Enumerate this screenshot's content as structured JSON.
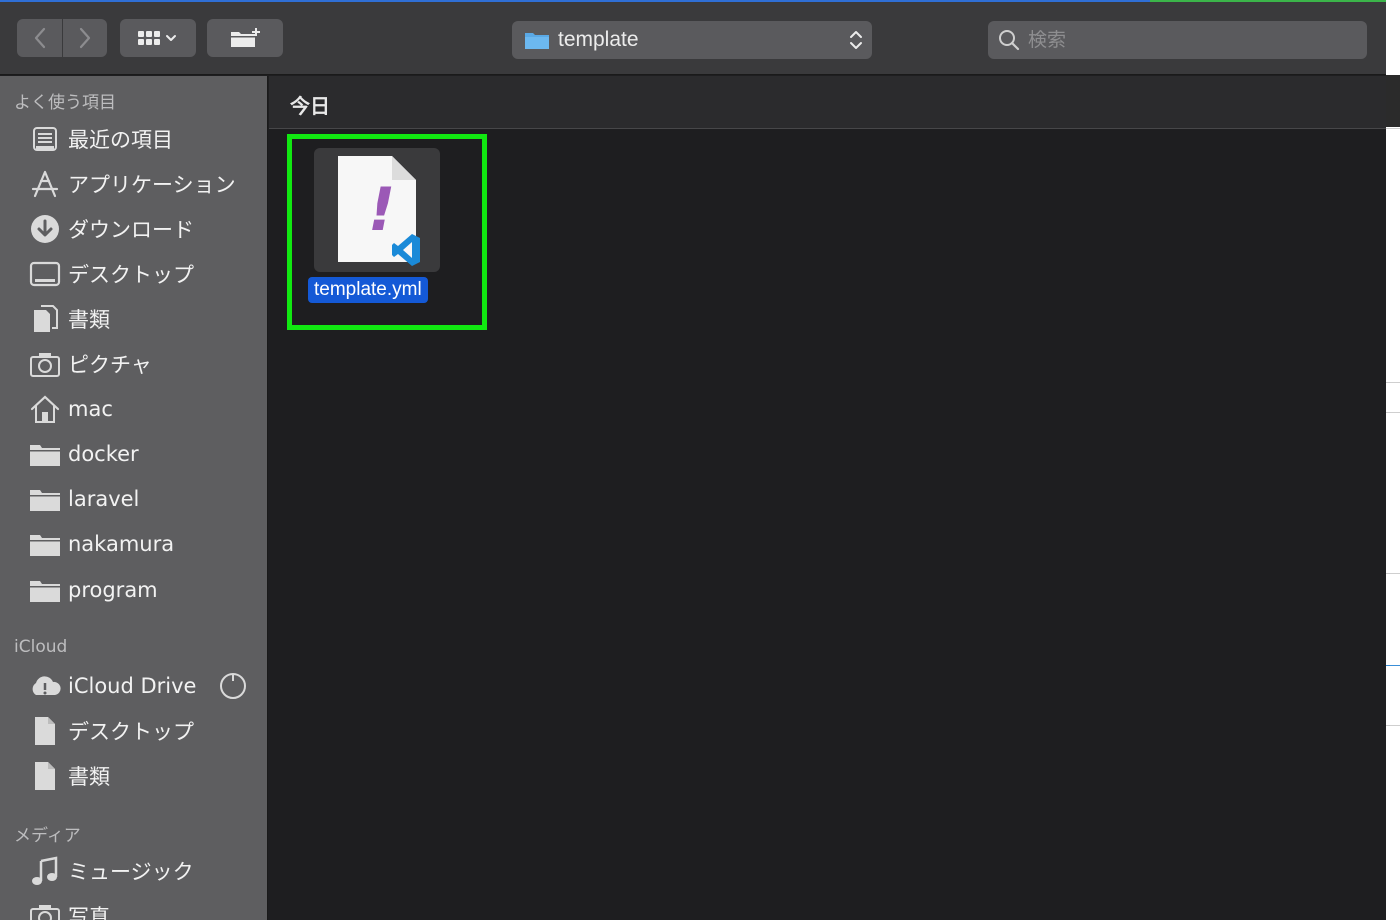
{
  "toolbar": {
    "back_icon": "chevron-left-icon",
    "forward_icon": "chevron-right-icon",
    "view_icon": "grid-view-icon",
    "new_folder_icon": "new-folder-icon",
    "path": "template",
    "search_placeholder": "検索"
  },
  "sidebar": {
    "favorites_title": "よく使う項目",
    "favorites": [
      {
        "label": "最近の項目",
        "icon": "recents-icon"
      },
      {
        "label": "アプリケーション",
        "icon": "applications-icon"
      },
      {
        "label": "ダウンロード",
        "icon": "download-icon"
      },
      {
        "label": "デスクトップ",
        "icon": "desktop-icon"
      },
      {
        "label": "書類",
        "icon": "documents-icon"
      },
      {
        "label": "ピクチャ",
        "icon": "camera-icon"
      },
      {
        "label": "mac",
        "icon": "home-icon"
      },
      {
        "label": "docker",
        "icon": "folder-icon"
      },
      {
        "label": "laravel",
        "icon": "folder-icon"
      },
      {
        "label": "nakamura",
        "icon": "folder-icon"
      },
      {
        "label": "program",
        "icon": "folder-icon"
      }
    ],
    "icloud_title": "iCloud",
    "icloud": [
      {
        "label": "iCloud Drive",
        "icon": "cloud-icon"
      },
      {
        "label": "デスクトップ",
        "icon": "document-icon"
      },
      {
        "label": "書類",
        "icon": "document-icon"
      }
    ],
    "media_title": "メディア",
    "media": [
      {
        "label": "ミュージック",
        "icon": "music-note-icon"
      },
      {
        "label": "写真",
        "icon": "camera-icon"
      }
    ]
  },
  "main": {
    "group_header": "今日",
    "files": [
      {
        "name": "template.yml",
        "icon": "yaml-vscode-file-icon",
        "selected": true
      }
    ]
  },
  "colors": {
    "highlight_border": "#11e811",
    "selection_blue": "#1459d6",
    "accent_purple": "#9b59b6",
    "vscode_blue": "#1a8ad8"
  }
}
